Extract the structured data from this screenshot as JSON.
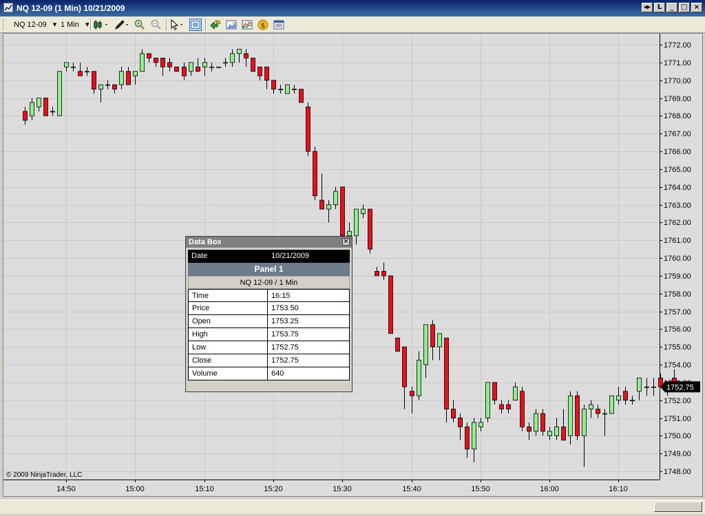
{
  "window": {
    "title": "NQ 12-09 (1 Min)  10/21/2009",
    "buttons": [
      "◂▸",
      "L",
      "_",
      "□",
      "×"
    ]
  },
  "toolbar": {
    "instrument": "NQ 12-09",
    "interval": "1 Min",
    "dropdown_glyph": "▾"
  },
  "chart": {
    "copyright": "© 2009 NinjaTrader, LLC",
    "last_price_label": "1752.75",
    "colors": {
      "up": "#90ee90",
      "down": "#e8101c",
      "background": "#dcdcdc",
      "grid": "#c8c8c8",
      "outline": "#000000"
    }
  },
  "chart_data": {
    "type": "candlestick",
    "y_ticks": [
      "1748.00",
      "1749.00",
      "1750.00",
      "1751.00",
      "1752.00",
      "1753.00",
      "1754.00",
      "1755.00",
      "1756.00",
      "1757.00",
      "1758.00",
      "1759.00",
      "1760.00",
      "1761.00",
      "1762.00",
      "1763.00",
      "1764.00",
      "1765.00",
      "1766.00",
      "1767.00",
      "1768.00",
      "1769.00",
      "1770.00",
      "1771.00",
      "1772.00"
    ],
    "ylim": [
      1748.0,
      1772.0
    ],
    "x_ticks": [
      "14:50",
      "15:00",
      "15:10",
      "15:20",
      "15:30",
      "15:40",
      "15:50",
      "16:00",
      "16:10"
    ],
    "x_range": [
      "14:43",
      "16:16"
    ],
    "candles": [
      {
        "t": "14:44",
        "o": 1768.25,
        "h": 1768.5,
        "l": 1767.5,
        "c": 1767.75
      },
      {
        "t": "14:45",
        "o": 1768.0,
        "h": 1769.0,
        "l": 1767.75,
        "c": 1768.75
      },
      {
        "t": "14:46",
        "o": 1768.5,
        "h": 1769.0,
        "l": 1768.25,
        "c": 1769.0
      },
      {
        "t": "14:47",
        "o": 1769.0,
        "h": 1769.0,
        "l": 1768.0,
        "c": 1768.0
      },
      {
        "t": "14:48",
        "o": 1768.25,
        "h": 1768.5,
        "l": 1768.0,
        "c": 1768.25
      },
      {
        "t": "14:49",
        "o": 1768.0,
        "h": 1770.5,
        "l": 1768.0,
        "c": 1770.5
      },
      {
        "t": "14:50",
        "o": 1770.75,
        "h": 1771.0,
        "l": 1770.5,
        "c": 1771.0
      },
      {
        "t": "14:51",
        "o": 1770.75,
        "h": 1771.0,
        "l": 1770.5,
        "c": 1770.75
      },
      {
        "t": "14:52",
        "o": 1770.5,
        "h": 1771.0,
        "l": 1770.25,
        "c": 1770.25
      },
      {
        "t": "14:53",
        "o": 1770.5,
        "h": 1770.75,
        "l": 1770.25,
        "c": 1770.5
      },
      {
        "t": "14:54",
        "o": 1770.5,
        "h": 1770.5,
        "l": 1769.25,
        "c": 1769.5
      },
      {
        "t": "14:55",
        "o": 1769.5,
        "h": 1769.75,
        "l": 1768.75,
        "c": 1769.75
      },
      {
        "t": "14:56",
        "o": 1769.75,
        "h": 1770.0,
        "l": 1769.5,
        "c": 1769.75
      },
      {
        "t": "14:57",
        "o": 1769.75,
        "h": 1769.75,
        "l": 1769.25,
        "c": 1769.5
      },
      {
        "t": "14:58",
        "o": 1769.75,
        "h": 1770.75,
        "l": 1769.5,
        "c": 1770.5
      },
      {
        "t": "14:59",
        "o": 1770.5,
        "h": 1770.75,
        "l": 1769.75,
        "c": 1769.75
      },
      {
        "t": "15:00",
        "o": 1770.25,
        "h": 1770.5,
        "l": 1769.75,
        "c": 1770.5
      },
      {
        "t": "15:01",
        "o": 1770.5,
        "h": 1771.75,
        "l": 1770.5,
        "c": 1771.5
      },
      {
        "t": "15:02",
        "o": 1771.5,
        "h": 1771.5,
        "l": 1771.0,
        "c": 1771.25
      },
      {
        "t": "15:03",
        "o": 1771.25,
        "h": 1771.25,
        "l": 1770.75,
        "c": 1771.0
      },
      {
        "t": "15:04",
        "o": 1771.25,
        "h": 1771.25,
        "l": 1770.25,
        "c": 1770.75
      },
      {
        "t": "15:05",
        "o": 1771.0,
        "h": 1771.25,
        "l": 1770.5,
        "c": 1770.75
      },
      {
        "t": "15:06",
        "o": 1770.75,
        "h": 1770.75,
        "l": 1770.5,
        "c": 1770.5
      },
      {
        "t": "15:07",
        "o": 1770.75,
        "h": 1771.0,
        "l": 1770.0,
        "c": 1770.25
      },
      {
        "t": "15:08",
        "o": 1770.5,
        "h": 1771.0,
        "l": 1770.25,
        "c": 1771.0
      },
      {
        "t": "15:09",
        "o": 1770.75,
        "h": 1771.25,
        "l": 1770.5,
        "c": 1770.5
      },
      {
        "t": "15:10",
        "o": 1770.75,
        "h": 1771.25,
        "l": 1770.25,
        "c": 1771.0
      },
      {
        "t": "15:11",
        "o": 1770.75,
        "h": 1771.0,
        "l": 1770.5,
        "c": 1770.75
      },
      {
        "t": "15:12",
        "o": 1770.75,
        "h": 1770.75,
        "l": 1770.75,
        "c": 1770.75
      },
      {
        "t": "15:13",
        "o": 1771.0,
        "h": 1771.25,
        "l": 1770.75,
        "c": 1771.0
      },
      {
        "t": "15:14",
        "o": 1771.0,
        "h": 1771.75,
        "l": 1770.75,
        "c": 1771.5
      },
      {
        "t": "15:15",
        "o": 1771.5,
        "h": 1771.75,
        "l": 1771.0,
        "c": 1771.75
      },
      {
        "t": "15:16",
        "o": 1771.5,
        "h": 1771.75,
        "l": 1770.75,
        "c": 1771.25
      },
      {
        "t": "15:17",
        "o": 1771.25,
        "h": 1771.25,
        "l": 1770.5,
        "c": 1770.5
      },
      {
        "t": "15:18",
        "o": 1770.75,
        "h": 1770.75,
        "l": 1770.0,
        "c": 1770.25
      },
      {
        "t": "15:19",
        "o": 1770.75,
        "h": 1770.75,
        "l": 1769.5,
        "c": 1770.0
      },
      {
        "t": "15:20",
        "o": 1770.0,
        "h": 1770.0,
        "l": 1769.25,
        "c": 1769.5
      },
      {
        "t": "15:21",
        "o": 1769.5,
        "h": 1769.75,
        "l": 1769.25,
        "c": 1769.5
      },
      {
        "t": "15:22",
        "o": 1769.25,
        "h": 1769.75,
        "l": 1769.25,
        "c": 1769.75
      },
      {
        "t": "15:23",
        "o": 1769.5,
        "h": 1769.75,
        "l": 1769.25,
        "c": 1769.5
      },
      {
        "t": "15:24",
        "o": 1769.5,
        "h": 1769.5,
        "l": 1768.75,
        "c": 1768.75
      },
      {
        "t": "15:25",
        "o": 1768.5,
        "h": 1768.75,
        "l": 1765.75,
        "c": 1766.0
      },
      {
        "t": "15:26",
        "o": 1766.0,
        "h": 1766.25,
        "l": 1763.25,
        "c": 1763.5
      },
      {
        "t": "15:27",
        "o": 1763.25,
        "h": 1764.75,
        "l": 1762.75,
        "c": 1762.75
      },
      {
        "t": "15:28",
        "o": 1762.75,
        "h": 1763.25,
        "l": 1762.0,
        "c": 1763.0
      },
      {
        "t": "15:29",
        "o": 1763.0,
        "h": 1764.0,
        "l": 1762.75,
        "c": 1763.75
      },
      {
        "t": "15:30",
        "o": 1764.0,
        "h": 1764.0,
        "l": 1761.0,
        "c": 1761.25
      },
      {
        "t": "15:31",
        "o": 1761.25,
        "h": 1762.0,
        "l": 1761.0,
        "c": 1761.5
      },
      {
        "t": "15:32",
        "o": 1761.25,
        "h": 1762.75,
        "l": 1760.75,
        "c": 1762.75
      },
      {
        "t": "15:33",
        "o": 1762.5,
        "h": 1763.0,
        "l": 1762.25,
        "c": 1762.75
      },
      {
        "t": "15:34",
        "o": 1762.75,
        "h": 1762.75,
        "l": 1760.25,
        "c": 1760.5
      },
      {
        "t": "15:35",
        "o": 1759.25,
        "h": 1759.5,
        "l": 1759.0,
        "c": 1759.0
      },
      {
        "t": "15:36",
        "o": 1759.25,
        "h": 1759.75,
        "l": 1758.75,
        "c": 1759.0
      },
      {
        "t": "15:37",
        "o": 1759.0,
        "h": 1759.0,
        "l": 1755.75,
        "c": 1755.75
      },
      {
        "t": "15:38",
        "o": 1755.5,
        "h": 1755.5,
        "l": 1754.75,
        "c": 1754.75
      },
      {
        "t": "15:39",
        "o": 1755.0,
        "h": 1755.0,
        "l": 1751.5,
        "c": 1752.75
      },
      {
        "t": "15:40",
        "o": 1752.5,
        "h": 1752.75,
        "l": 1751.25,
        "c": 1752.25
      },
      {
        "t": "15:41",
        "o": 1752.25,
        "h": 1754.75,
        "l": 1752.0,
        "c": 1754.25
      },
      {
        "t": "15:42",
        "o": 1754.0,
        "h": 1756.25,
        "l": 1753.25,
        "c": 1756.25
      },
      {
        "t": "15:43",
        "o": 1756.25,
        "h": 1756.5,
        "l": 1754.25,
        "c": 1755.0
      },
      {
        "t": "15:44",
        "o": 1755.0,
        "h": 1755.75,
        "l": 1754.25,
        "c": 1755.75
      },
      {
        "t": "15:45",
        "o": 1755.5,
        "h": 1755.5,
        "l": 1750.75,
        "c": 1751.5
      },
      {
        "t": "15:46",
        "o": 1751.5,
        "h": 1752.0,
        "l": 1750.75,
        "c": 1751.0
      },
      {
        "t": "15:47",
        "o": 1751.0,
        "h": 1751.25,
        "l": 1749.75,
        "c": 1750.5
      },
      {
        "t": "15:48",
        "o": 1750.5,
        "h": 1750.75,
        "l": 1748.75,
        "c": 1749.25
      },
      {
        "t": "15:49",
        "o": 1749.25,
        "h": 1751.0,
        "l": 1748.5,
        "c": 1750.75
      },
      {
        "t": "15:50",
        "o": 1750.5,
        "h": 1751.0,
        "l": 1750.25,
        "c": 1750.75
      },
      {
        "t": "15:51",
        "o": 1751.0,
        "h": 1753.0,
        "l": 1750.75,
        "c": 1753.0
      },
      {
        "t": "15:52",
        "o": 1753.0,
        "h": 1753.0,
        "l": 1751.75,
        "c": 1752.0
      },
      {
        "t": "15:53",
        "o": 1751.75,
        "h": 1752.0,
        "l": 1751.25,
        "c": 1751.5
      },
      {
        "t": "15:54",
        "o": 1751.75,
        "h": 1752.0,
        "l": 1751.25,
        "c": 1751.5
      },
      {
        "t": "15:55",
        "o": 1752.0,
        "h": 1753.0,
        "l": 1752.0,
        "c": 1752.75
      },
      {
        "t": "15:56",
        "o": 1752.5,
        "h": 1752.75,
        "l": 1750.25,
        "c": 1750.5
      },
      {
        "t": "15:57",
        "o": 1750.5,
        "h": 1750.75,
        "l": 1749.75,
        "c": 1750.25
      },
      {
        "t": "15:58",
        "o": 1750.25,
        "h": 1751.5,
        "l": 1750.0,
        "c": 1751.25
      },
      {
        "t": "15:59",
        "o": 1751.25,
        "h": 1751.5,
        "l": 1750.0,
        "c": 1750.25
      },
      {
        "t": "16:00",
        "o": 1750.0,
        "h": 1750.5,
        "l": 1749.75,
        "c": 1750.25
      },
      {
        "t": "16:01",
        "o": 1750.0,
        "h": 1751.0,
        "l": 1749.75,
        "c": 1750.5
      },
      {
        "t": "16:02",
        "o": 1750.5,
        "h": 1751.5,
        "l": 1749.75,
        "c": 1749.75
      },
      {
        "t": "16:03",
        "o": 1750.0,
        "h": 1752.5,
        "l": 1749.5,
        "c": 1752.25
      },
      {
        "t": "16:04",
        "o": 1752.25,
        "h": 1752.5,
        "l": 1749.75,
        "c": 1750.0
      },
      {
        "t": "16:05",
        "o": 1750.0,
        "h": 1751.75,
        "l": 1748.25,
        "c": 1751.5
      },
      {
        "t": "16:06",
        "o": 1751.5,
        "h": 1752.0,
        "l": 1751.0,
        "c": 1751.75
      },
      {
        "t": "16:07",
        "o": 1751.5,
        "h": 1751.75,
        "l": 1751.0,
        "c": 1751.25
      },
      {
        "t": "16:08",
        "o": 1751.25,
        "h": 1751.5,
        "l": 1750.0,
        "c": 1751.25
      },
      {
        "t": "16:09",
        "o": 1751.25,
        "h": 1752.25,
        "l": 1751.25,
        "c": 1752.25
      },
      {
        "t": "16:10",
        "o": 1752.0,
        "h": 1752.75,
        "l": 1751.75,
        "c": 1752.25
      },
      {
        "t": "16:11",
        "o": 1752.5,
        "h": 1752.75,
        "l": 1751.75,
        "c": 1752.0
      },
      {
        "t": "16:12",
        "o": 1752.0,
        "h": 1752.25,
        "l": 1751.75,
        "c": 1752.0
      },
      {
        "t": "16:13",
        "o": 1752.5,
        "h": 1753.25,
        "l": 1752.0,
        "c": 1753.25
      },
      {
        "t": "16:14",
        "o": 1752.75,
        "h": 1753.25,
        "l": 1752.25,
        "c": 1752.75
      },
      {
        "t": "16:15",
        "o": 1752.75,
        "h": 1753.25,
        "l": 1752.25,
        "c": 1752.75
      },
      {
        "t": "16:16",
        "o": 1753.25,
        "h": 1753.5,
        "l": 1752.75,
        "c": 1752.75
      },
      {
        "t": "16:17",
        "o": 1752.75,
        "h": 1753.0,
        "l": 1752.25,
        "c": 1753.0
      },
      {
        "t": "16:18",
        "o": 1753.25,
        "h": 1753.75,
        "l": 1752.75,
        "c": 1752.75
      }
    ]
  },
  "databox": {
    "title": "Data Box",
    "close": "×",
    "date_label": "Date",
    "date_value": "10/21/2009",
    "panel": "Panel 1",
    "instrument": "NQ 12-09 / 1 Min",
    "rows": [
      {
        "label": "Time",
        "value": "16:15"
      },
      {
        "label": "Price",
        "value": "1753.50"
      },
      {
        "label": "Open",
        "value": "1753.25"
      },
      {
        "label": "High",
        "value": "1753.75"
      },
      {
        "label": "Low",
        "value": "1752.75"
      },
      {
        "label": "Close",
        "value": "1752.75"
      },
      {
        "label": "Volume",
        "value": "640"
      }
    ]
  }
}
